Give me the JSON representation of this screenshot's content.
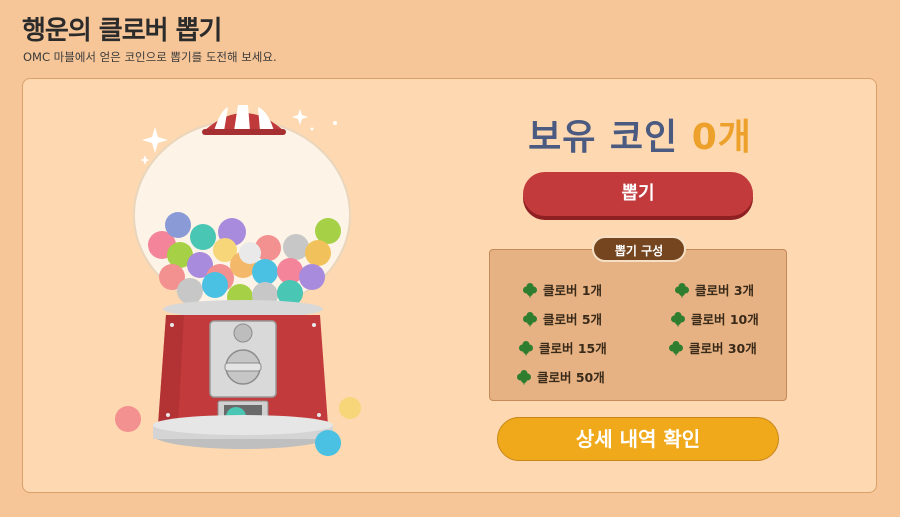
{
  "header": {
    "title": "행운의 클로버 뽑기",
    "subtitle": "OMC 마블에서 얻은 코인으로 뽑기를 도전해 보세요."
  },
  "coins": {
    "label": "보유 코인",
    "count": "0개",
    "count_color": "#eda12a",
    "label_color": "#4a5a80"
  },
  "draw_button": {
    "label": "뽑기",
    "color": "#c23a3b"
  },
  "rewards": {
    "title": "뽑기 구성",
    "items": [
      {
        "label": "클로버 1개"
      },
      {
        "label": "클로버 3개"
      },
      {
        "label": "클로버 5개"
      },
      {
        "label": "클로버 10개"
      },
      {
        "label": "클로버 15개"
      },
      {
        "label": "클로버 30개"
      },
      {
        "label": "클로버 50개"
      }
    ],
    "icon": "clover-icon"
  },
  "detail_button": {
    "label": "상세 내역 확인",
    "color": "#f0a91b"
  },
  "illustration": {
    "icon": "gumball-machine-icon"
  }
}
